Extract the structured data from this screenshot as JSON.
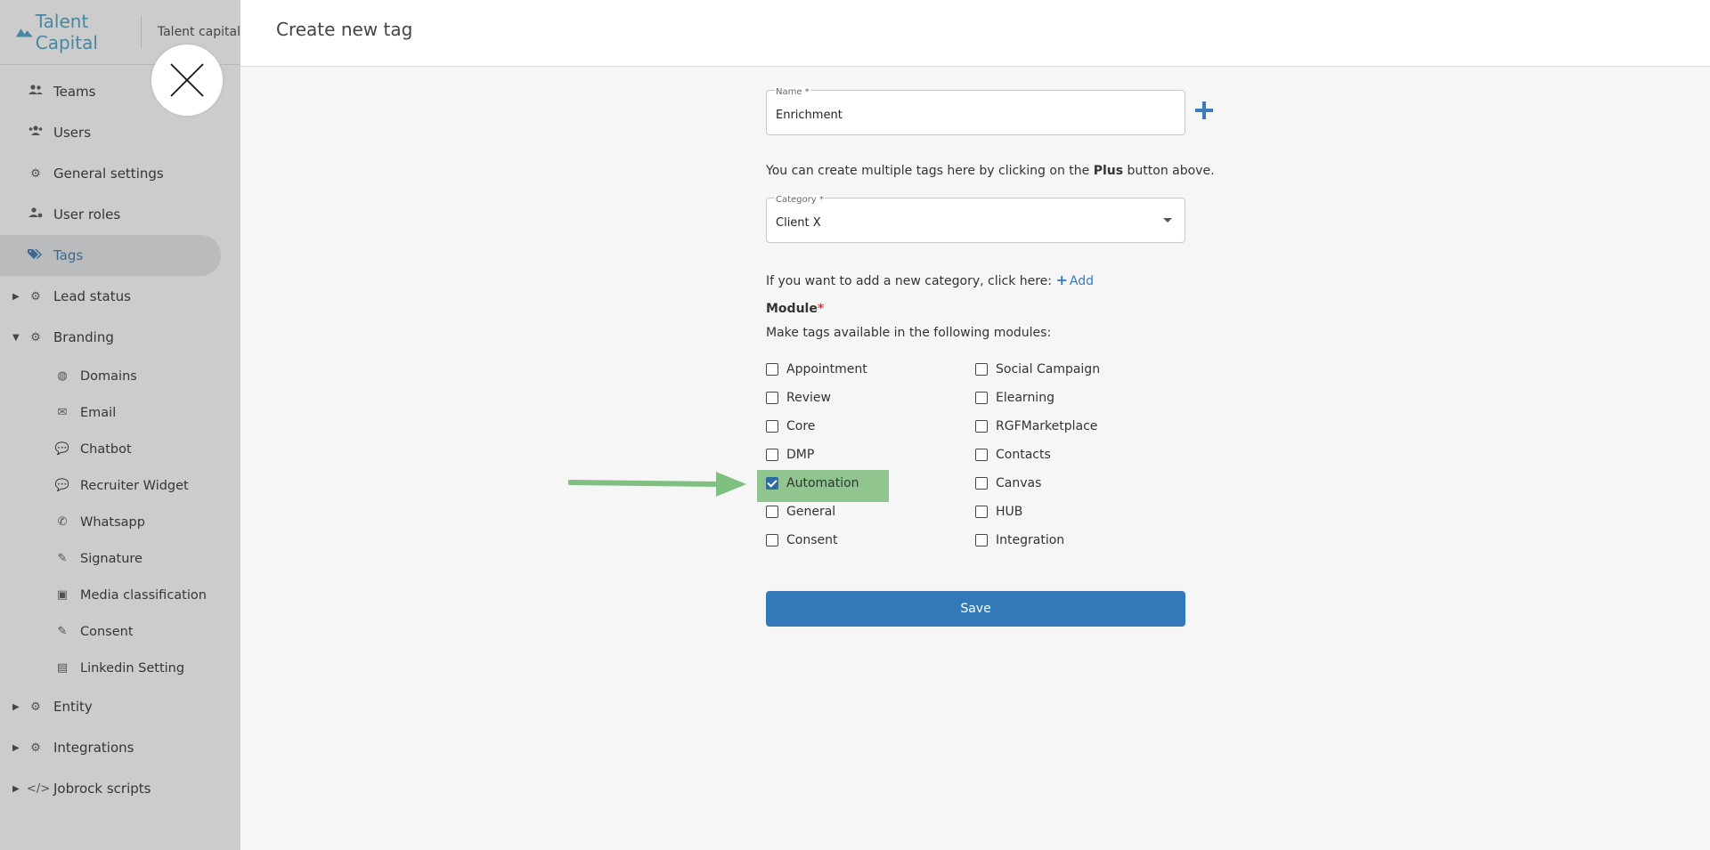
{
  "app": {
    "brand": "Talent Capital",
    "company_name": "Talent capital"
  },
  "sidebar": {
    "items": [
      {
        "label": "Teams",
        "icon": "users-icon"
      },
      {
        "label": "Users",
        "icon": "users-group-icon"
      },
      {
        "label": "General settings",
        "icon": "gear-icon"
      },
      {
        "label": "User roles",
        "icon": "user-gear-icon"
      },
      {
        "label": "Tags",
        "icon": "tags-icon",
        "active": true
      },
      {
        "label": "Lead status",
        "icon": "gears-icon",
        "collapsed": true
      },
      {
        "label": "Branding",
        "icon": "gears-icon",
        "expanded": true
      },
      {
        "label": "Domains",
        "icon": "globe-icon"
      },
      {
        "label": "Email",
        "icon": "envelope-icon"
      },
      {
        "label": "Chatbot",
        "icon": "chat-icon"
      },
      {
        "label": "Recruiter Widget",
        "icon": "chat-icon"
      },
      {
        "label": "Whatsapp",
        "icon": "whatsapp-icon"
      },
      {
        "label": "Signature",
        "icon": "signature-icon"
      },
      {
        "label": "Media classification",
        "icon": "images-icon"
      },
      {
        "label": "Consent",
        "icon": "signature-icon"
      },
      {
        "label": "Linkedin Setting",
        "icon": "linkedin-icon"
      },
      {
        "label": "Entity",
        "icon": "gears-icon",
        "collapsed": true
      },
      {
        "label": "Integrations",
        "icon": "gears-icon",
        "collapsed": true
      },
      {
        "label": "Jobrock scripts",
        "icon": "code-icon",
        "collapsed": true
      }
    ]
  },
  "page": {
    "title": "Create new tag"
  },
  "form": {
    "name_label": "Name *",
    "name_value": "Enrichment",
    "multi_hint_prefix": "You can create multiple tags here by clicking on the ",
    "multi_hint_bold": "Plus",
    "multi_hint_suffix": " button above.",
    "category_label": "Category *",
    "category_value": "Client X",
    "category_hint": "If you want to add a new category, click here:",
    "add_label": "Add",
    "module_label": "Module",
    "module_required": "*",
    "module_hint": "Make tags available in the following modules:",
    "modules_left": [
      {
        "label": "Appointment",
        "checked": false
      },
      {
        "label": "Review",
        "checked": false
      },
      {
        "label": "Core",
        "checked": false
      },
      {
        "label": "DMP",
        "checked": false
      },
      {
        "label": "Automation",
        "checked": true
      },
      {
        "label": "General",
        "checked": false
      },
      {
        "label": "Consent",
        "checked": false
      }
    ],
    "modules_right": [
      {
        "label": "Social Campaign",
        "checked": false
      },
      {
        "label": "Elearning",
        "checked": false
      },
      {
        "label": "RGFMarketplace",
        "checked": false
      },
      {
        "label": "Contacts",
        "checked": false
      },
      {
        "label": "Canvas",
        "checked": false
      },
      {
        "label": "HUB",
        "checked": false
      },
      {
        "label": "Integration",
        "checked": false
      }
    ],
    "save_label": "Save"
  },
  "colors": {
    "accent": "#3479b7",
    "brand": "#5aa9c8",
    "highlight": "#6eb46e",
    "required": "#e53935"
  }
}
